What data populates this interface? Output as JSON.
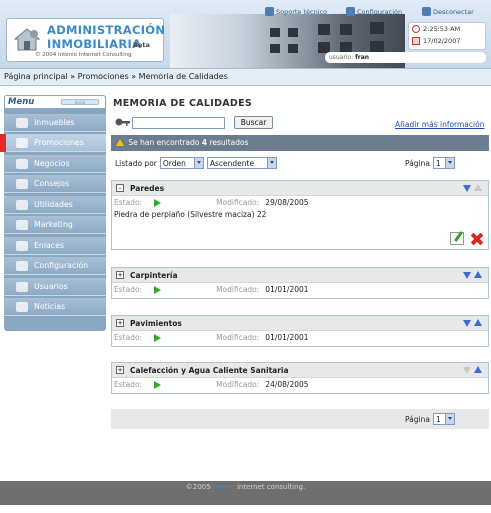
{
  "header": {
    "logo_line1": "ADMINISTRACIÓN",
    "logo_line2": "INMOBILIARIA",
    "logo_beta": "Beta",
    "logo_copyright": "© 2004 Intenio Internet Consulting",
    "links": {
      "support": "Soporte técnico",
      "config": "Configuración",
      "logout": "Desconectar"
    },
    "time": "2:25:53 AM",
    "date": "17/02/2007",
    "user_label": "usuario:",
    "user_name": "fran"
  },
  "breadcrumb": "Página principal » Promociones » Memoria de Calidades",
  "sidebar": {
    "title": "Menu",
    "tab_label": "Inicio",
    "items": [
      {
        "label": "Inmuebles",
        "icon": "house-icon"
      },
      {
        "label": "Promociones",
        "icon": "promotions-icon",
        "active": true
      },
      {
        "label": "Negocios",
        "icon": "briefcase-icon"
      },
      {
        "label": "Consejos",
        "icon": "tips-icon"
      },
      {
        "label": "Utilidades",
        "icon": "tools-icon"
      },
      {
        "label": "Marketing",
        "icon": "marketing-icon"
      },
      {
        "label": "Enlaces",
        "icon": "links-icon"
      },
      {
        "label": "Configuración",
        "icon": "gear-icon"
      },
      {
        "label": "Usuarios",
        "icon": "users-icon"
      },
      {
        "label": "Noticias",
        "icon": "news-icon"
      }
    ]
  },
  "main": {
    "title": "MEMORIA DE CALIDADES",
    "search_button": "Buscar",
    "search_value": "",
    "add_link": "Añadir más información",
    "results_prefix": "Se han encontrado",
    "results_count": "4",
    "results_suffix": "resultados",
    "sort_label": "Listado por",
    "sort_field": "Orden",
    "sort_dir": "Ascendente",
    "page_label": "Página",
    "page_value": "1",
    "estado_label": "Estado:",
    "modificado_label": "Modificado:"
  },
  "records": [
    {
      "title": "Paredes",
      "modified": "29/08/2005",
      "description": "Piedra de perpiaño (Silvestre maciza) 22",
      "expanded": true
    },
    {
      "title": "Carpintería",
      "modified": "01/01/2001",
      "expanded": false
    },
    {
      "title": "Pavimientos",
      "modified": "01/01/2001",
      "expanded": false
    },
    {
      "title": "Calefacción y Agua Caliente Sanitaria",
      "modified": "24/08/2005",
      "expanded": false
    }
  ],
  "footer": {
    "prefix": "©2005",
    "brand": "intenio",
    "suffix": "internet consulting."
  }
}
